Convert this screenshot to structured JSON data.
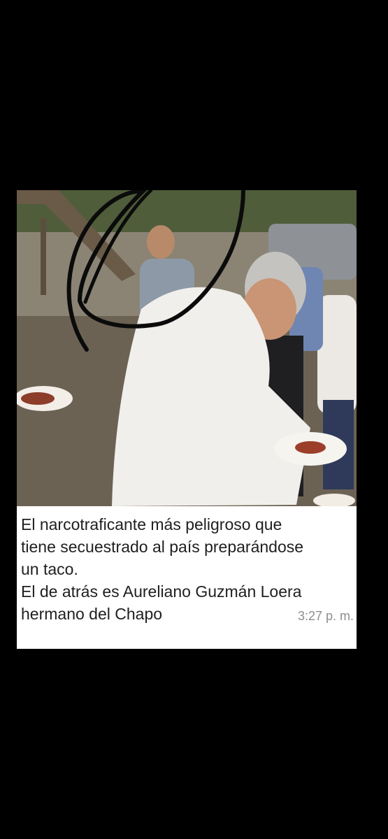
{
  "message": {
    "photo_description_icon": "photo-icon",
    "caption_lines": [
      "El narcotraficante más peligroso que",
      "tiene secuestrado al país preparándose",
      "un taco.",
      "El de atrás es Aureliano Guzmán Loera",
      "hermano del Chapo"
    ],
    "timestamp": "3:27 p. m."
  },
  "colors": {
    "background": "#000000",
    "card": "#ffffff",
    "caption_text": "#1f1f1f",
    "timestamp_text": "#8d8d8d",
    "marker_scribble": "#0b0b0b"
  }
}
